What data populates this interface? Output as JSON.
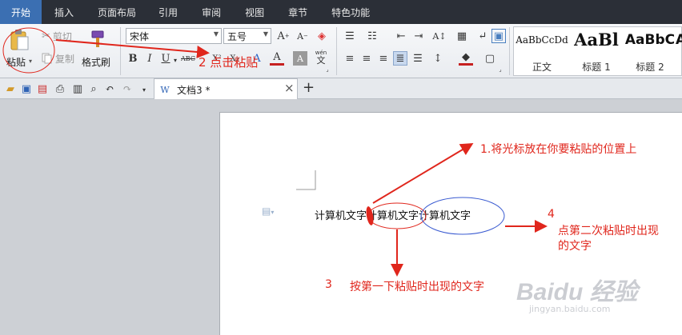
{
  "menu": {
    "tabs": [
      "开始",
      "插入",
      "页面布局",
      "引用",
      "审阅",
      "视图",
      "章节",
      "特色功能"
    ],
    "active_index": 0
  },
  "ribbon": {
    "paste_label": "粘贴",
    "cut_label": "剪切",
    "copy_label": "复制",
    "format_painter_label": "格式刷",
    "font_name": "宋体",
    "font_size": "五号",
    "text_direction_label": "wén",
    "styles": [
      {
        "sample": "AaBbCcDd",
        "name": "正文"
      },
      {
        "sample": "AaBl",
        "name": "标题 1"
      },
      {
        "sample": "AaBbC",
        "name": "标题 2"
      },
      {
        "sample": "A",
        "name": ""
      }
    ]
  },
  "doc_tab": {
    "title": "文档3 *",
    "close": "×",
    "add": "+"
  },
  "document": {
    "line_text": [
      "计算机文字",
      "计算机文字",
      "计算机文字"
    ]
  },
  "annotations": {
    "step1": "1.将光标放在你要粘贴的位置上",
    "step2": "2 点击粘贴",
    "step3_num": "3",
    "step3_text": "按第一下粘贴时出现的文字",
    "step4_num": "4",
    "step4_text_line1": "点第二次粘贴时出现",
    "step4_text_line2": "的文字"
  },
  "watermark": {
    "logo": "Baidu 经验",
    "url": "jingyan.baidu.com"
  },
  "colors": {
    "accent_tab": "#3b6fb2",
    "annotation_red": "#e0261c",
    "ellipse_blue": "#3a5bd1"
  }
}
